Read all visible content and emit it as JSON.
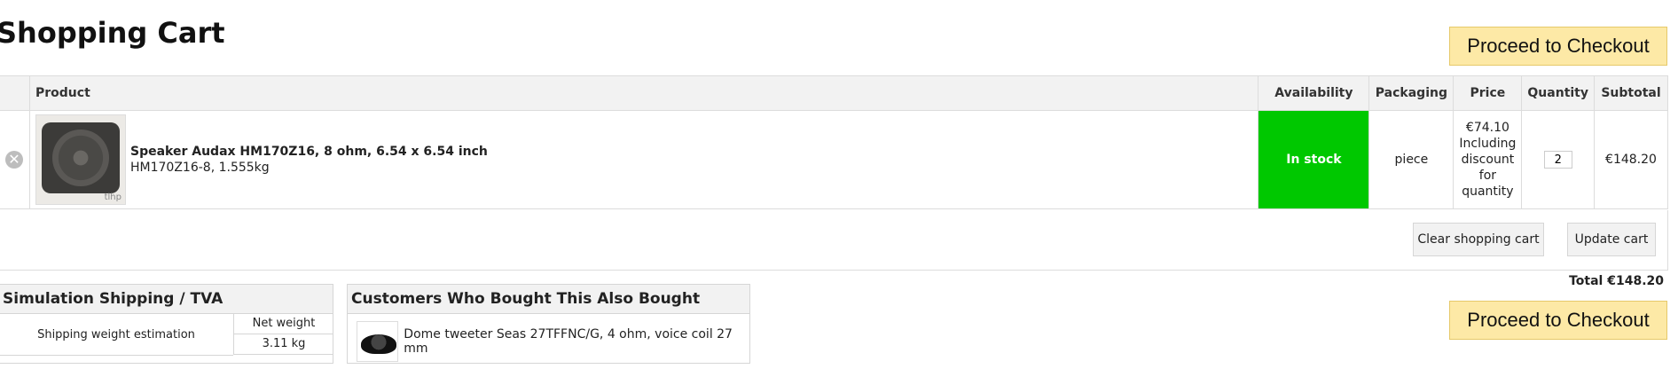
{
  "page": {
    "title": "Shopping Cart"
  },
  "checkout": {
    "label": "Proceed to Checkout"
  },
  "table": {
    "headers": {
      "product": "Product",
      "availability": "Availability",
      "packaging": "Packaging",
      "price": "Price",
      "quantity": "Quantity",
      "subtotal": "Subtotal"
    },
    "items": [
      {
        "name": "Speaker Audax HM170Z16, 8 ohm, 6.54 x 6.54 inch",
        "detail": "HM170Z16-8, 1.555kg",
        "image_brand": "tlhp",
        "availability": "In stock",
        "packaging": "piece",
        "price": "€74.10",
        "price_note": "Including discount for quantity",
        "quantity": "2",
        "subtotal": "€148.20"
      }
    ]
  },
  "actions": {
    "clear": "Clear shopping cart",
    "update": "Update cart"
  },
  "total": {
    "label": "Total",
    "value": "€148.20"
  },
  "shipping": {
    "title": "Simulation Shipping / TVA",
    "label": "Shipping weight estimation",
    "weight_header": "Net weight",
    "weight_value": "3.11 kg"
  },
  "also_bought": {
    "title": "Customers Who Bought This Also Bought",
    "items": [
      {
        "name": "Dome tweeter Seas 27TFFNC/G, 4 ohm, voice coil 27 mm"
      }
    ]
  },
  "colors": {
    "in_stock": "#00c800",
    "checkout_bg": "#fde9a6",
    "header_bg": "#f2f2f2"
  }
}
